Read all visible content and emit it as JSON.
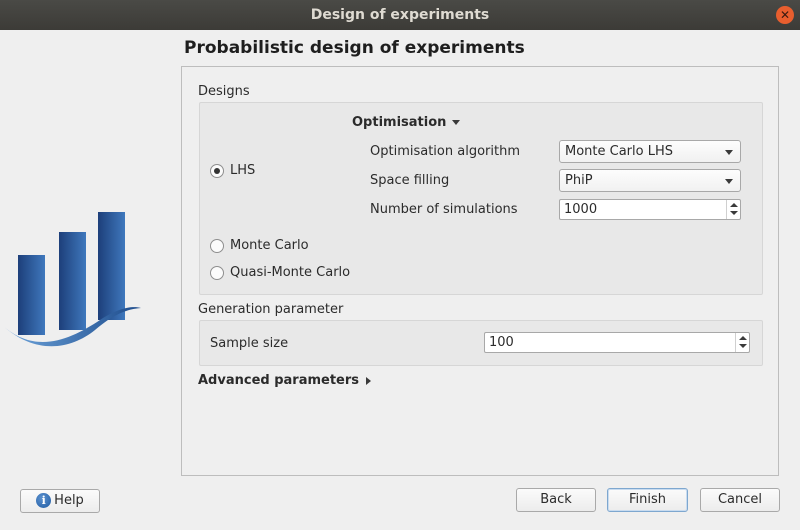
{
  "window": {
    "title": "Design of experiments",
    "close_icon": "close-icon"
  },
  "page": {
    "title": "Probabilistic design of experiments"
  },
  "designs": {
    "label": "Designs",
    "options": [
      {
        "label": "LHS",
        "selected": true
      },
      {
        "label": "Monte Carlo",
        "selected": false
      },
      {
        "label": "Quasi-Monte Carlo",
        "selected": false
      }
    ],
    "optimisation": {
      "header": "Optimisation",
      "expanded": true,
      "algorithm": {
        "label": "Optimisation algorithm",
        "value": "Monte Carlo LHS"
      },
      "space_filling": {
        "label": "Space filling",
        "value": "PhiP"
      },
      "simulations": {
        "label": "Number of simulations",
        "value": "1000"
      }
    }
  },
  "generation": {
    "label": "Generation parameter",
    "sample_size": {
      "label": "Sample size",
      "value": "100"
    }
  },
  "advanced": {
    "label": "Advanced parameters",
    "expanded": false
  },
  "buttons": {
    "help": "Help",
    "back": "Back",
    "finish": "Finish",
    "cancel": "Cancel"
  },
  "colors": {
    "accent": "#2f67b1",
    "titlebar": "#3c3b37",
    "close": "#e85e2e"
  }
}
